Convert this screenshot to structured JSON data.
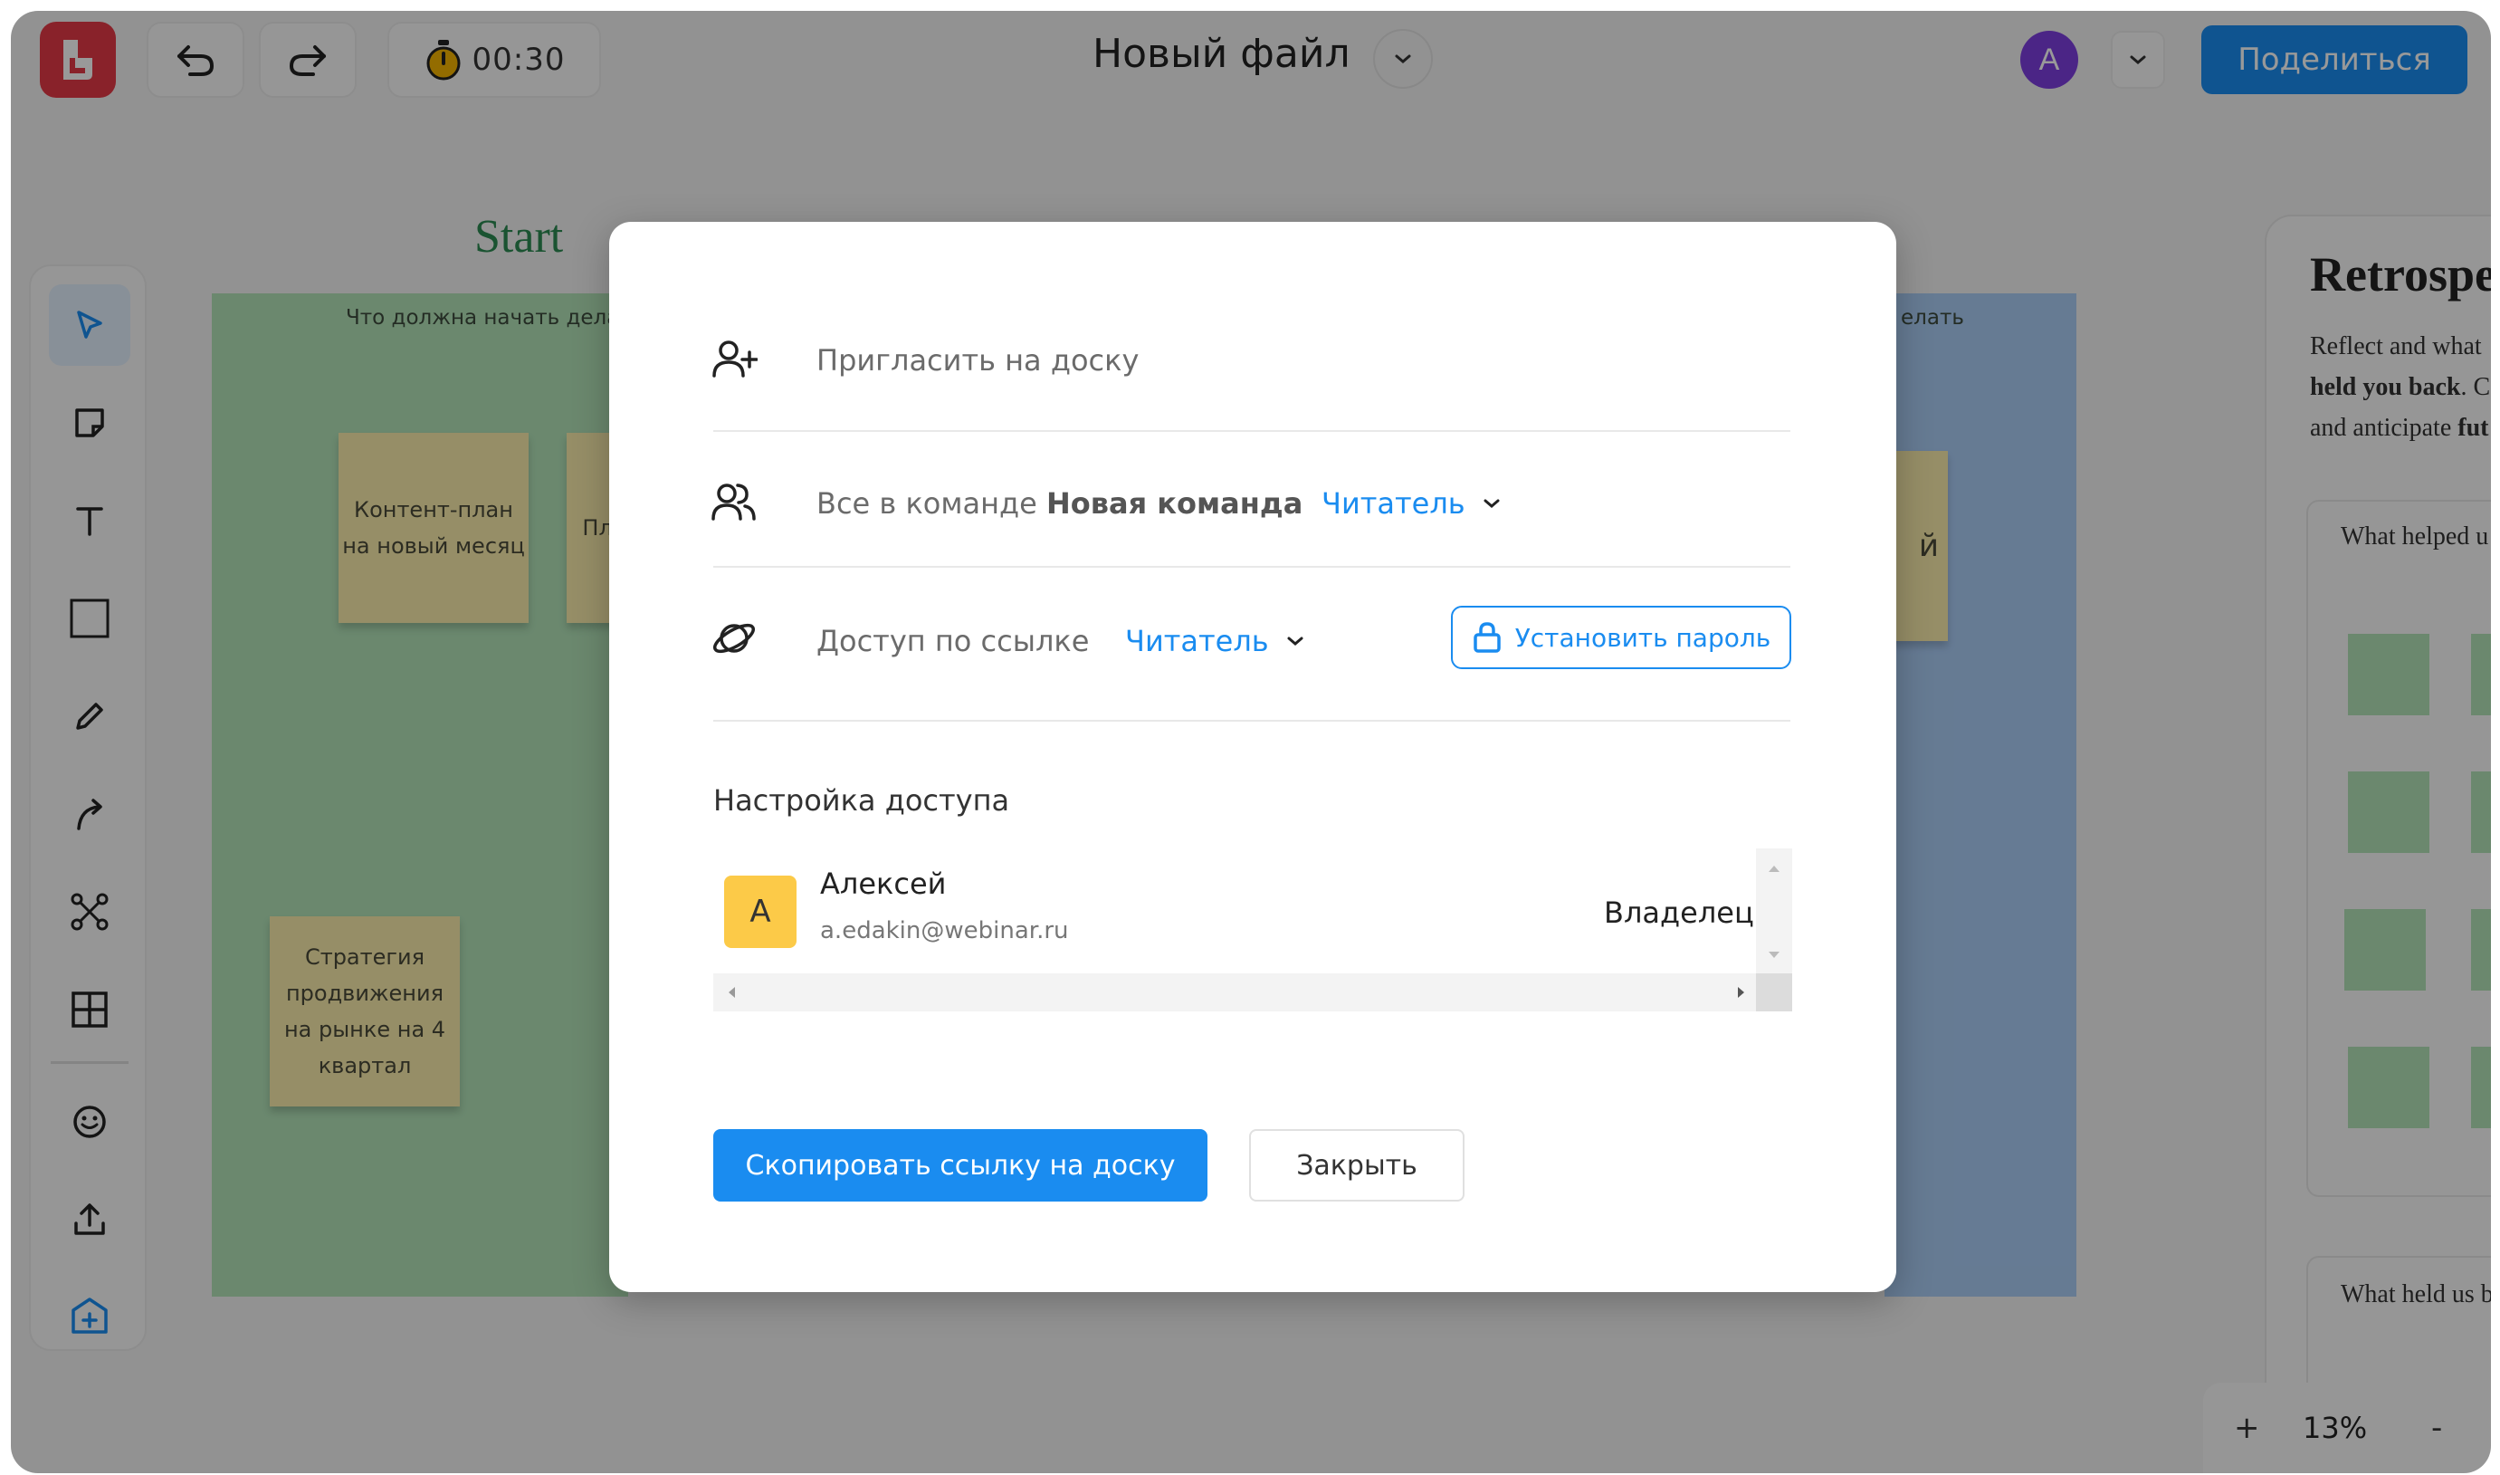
{
  "header": {
    "timer": "00:30",
    "file_title": "Новый файл",
    "avatar_initial": "A",
    "share_label": "Поделиться"
  },
  "board": {
    "start_title": "Start",
    "green_caption": "Что должна начать делать",
    "blue_caption": "елать",
    "stickies": [
      "Контент-план на новый месяц",
      "Пл в",
      "Стратегия продвижения на рынке на 4 квартал",
      "й"
    ]
  },
  "retro": {
    "title": "Retrospe",
    "desc_line1": "Reflect and what",
    "desc_line2_bold": "held you back",
    "desc_line2_rest": ". C",
    "desc_line3": "and anticipate ",
    "desc_line3_bold": "fut",
    "box1_label": "What helped u",
    "box2_label": "What held us b"
  },
  "zoom": {
    "plus": "+",
    "level": "13%",
    "minus": "-"
  },
  "modal": {
    "invite_label": "Пригласить на доску",
    "team_prefix": "Все в команде ",
    "team_name": "Новая команда",
    "team_role": "Читатель",
    "link_label": "Доступ по ссылке",
    "link_role": "Читатель",
    "password_button": "Установить пароль",
    "access_title": "Настройка доступа",
    "users": [
      {
        "initial": "А",
        "name": "Алексей",
        "email": "a.edakin@webinar.ru",
        "role": "Владелец"
      }
    ],
    "copy_button": "Скопировать ссылку на доску",
    "close_button": "Закрыть"
  },
  "colors": {
    "accent": "#1a8cf0",
    "logo": "#e53a46",
    "avatar": "#7d3ee0",
    "user_avatar": "#fcca48",
    "frame_green": "#b2e3b8",
    "frame_blue": "#aacdf6",
    "sticky": "#fbedac"
  }
}
